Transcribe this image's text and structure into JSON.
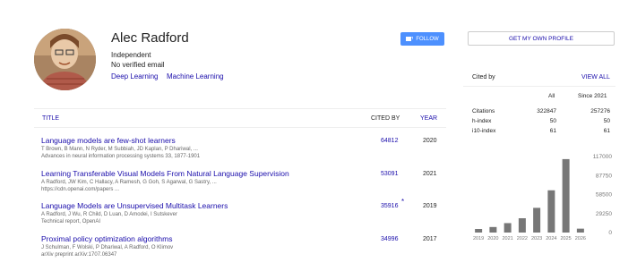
{
  "profile": {
    "name": "Alec Radford",
    "affiliation": "Independent",
    "email_status": "No verified email",
    "interests": [
      "Deep Learning",
      "Machine Learning"
    ],
    "follow_label": "FOLLOW"
  },
  "table": {
    "headers": {
      "title": "TITLE",
      "cited_by": "CITED BY",
      "year": "YEAR"
    },
    "rows": [
      {
        "title": "Language models are few-shot learners",
        "authors": "T Brown, B Mann, N Ryder, M Subbiah, JD Kaplan, P Dhariwal, ...",
        "venue": "Advances in neural information processing systems 33, 1877-1901",
        "cited_by": "64812",
        "star": "",
        "year": "2020"
      },
      {
        "title": "Learning Transferable Visual Models From Natural Language Supervision",
        "authors": "A Radford, JW Kim, C Hallacy, A Ramesh, G Goh, S Agarwal, G Sastry, ...",
        "venue": "https://cdn.openai.com/papers ...",
        "cited_by": "53091",
        "star": "",
        "year": "2021"
      },
      {
        "title": "Language Models are Unsupervised Multitask Learners",
        "authors": "A Radford, J Wu, R Child, D Luan, D Amodei, I Sutskever",
        "venue": "Technical report, OpenAI",
        "cited_by": "35916",
        "star": "*",
        "year": "2019"
      },
      {
        "title": "Proximal policy optimization algorithms",
        "authors": "J Schulman, F Wolski, P Dhariwal, A Radford, O Klimov",
        "venue": "arXiv preprint arXiv:1707.06347",
        "cited_by": "34996",
        "star": "",
        "year": "2017"
      }
    ]
  },
  "sidebar": {
    "my_profile_label": "GET MY OWN PROFILE",
    "cited_by_label": "Cited by",
    "view_all_label": "VIEW ALL",
    "col_all": "All",
    "col_since": "Since 2021",
    "metrics": [
      {
        "label": "Citations",
        "all": "322847",
        "since": "257276"
      },
      {
        "label": "h-index",
        "all": "50",
        "since": "50"
      },
      {
        "label": "i10-index",
        "all": "61",
        "since": "61"
      }
    ]
  },
  "chart_data": {
    "type": "bar",
    "categories": [
      "2019",
      "2020",
      "2021",
      "2022",
      "2023",
      "2024",
      "2025",
      "2026"
    ],
    "values": [
      5500,
      8500,
      14500,
      22000,
      38000,
      65000,
      113000,
      6000
    ],
    "yticks": [
      "117000",
      "87750",
      "58500",
      "29250",
      "0"
    ],
    "ylim": [
      0,
      117000
    ],
    "bar_color": "#777777"
  }
}
